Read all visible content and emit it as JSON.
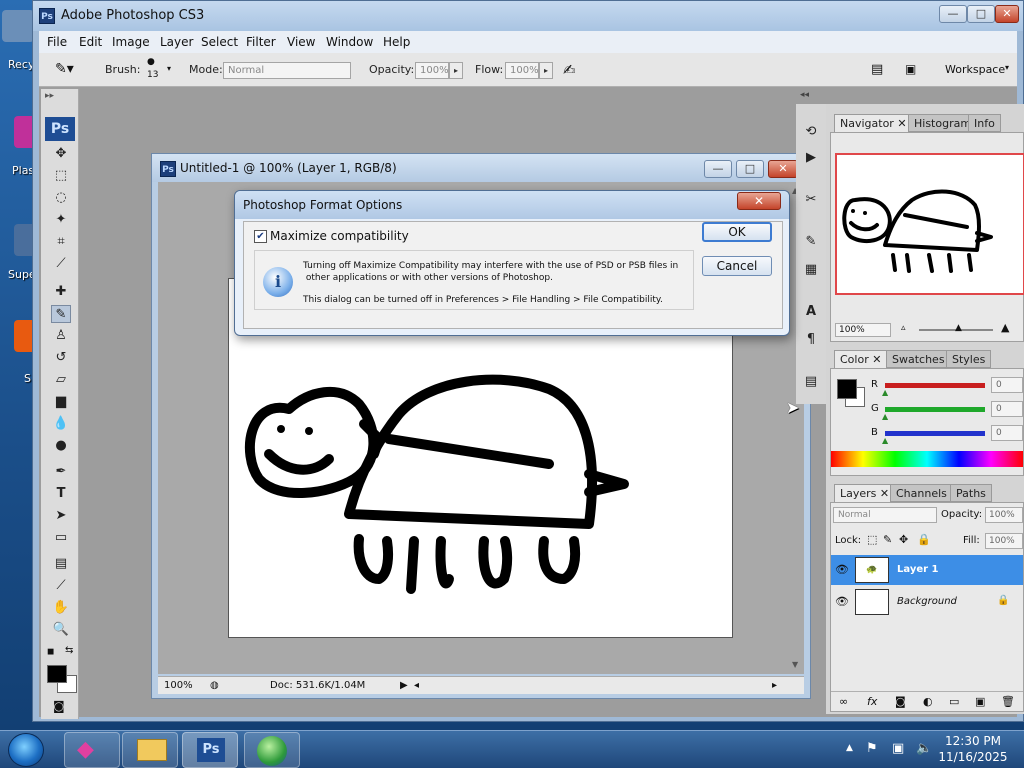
{
  "desktop": {
    "icons": [
      {
        "label": "Recy",
        "color": "#6b8fb8"
      },
      {
        "label": "Plas",
        "color": "#c0309a"
      },
      {
        "label": "Supe",
        "color": "#4a6e9c"
      },
      {
        "label": "S",
        "color": "#e85a10"
      }
    ]
  },
  "window": {
    "app_icon": "Ps",
    "title": "Adobe Photoshop CS3",
    "controls": {
      "minimize": "—",
      "maximize": "□",
      "close": "✕"
    }
  },
  "menubar": [
    "File",
    "Edit",
    "Image",
    "Layer",
    "Select",
    "Filter",
    "View",
    "Window",
    "Help"
  ],
  "options_bar": {
    "brush_label": "Brush:",
    "brush_size": "13",
    "mode_label": "Mode:",
    "mode_value": "Normal",
    "opacity_label": "Opacity:",
    "opacity_value": "100%",
    "flow_label": "Flow:",
    "flow_value": "100%",
    "workspace_label": "Workspace"
  },
  "toolbox": {
    "logo": "Ps",
    "tools": [
      "move-tool",
      "marquee-tool",
      "lasso-tool",
      "magic-wand-tool",
      "crop-tool",
      "slice-tool",
      "healing-brush-tool",
      "brush-tool",
      "clone-stamp-tool",
      "history-brush-tool",
      "eraser-tool",
      "gradient-tool",
      "blur-tool",
      "dodge-tool",
      "pen-tool",
      "type-tool",
      "path-selection-tool",
      "shape-tool",
      "notes-tool",
      "eyedropper-tool",
      "hand-tool",
      "zoom-tool"
    ],
    "foreground_color": "#000000",
    "background_color": "#ffffff"
  },
  "document": {
    "title": "Untitled-1 @ 100% (Layer 1, RGB/8)",
    "zoom": "100%",
    "doc_info": "Doc: 531.6K/1.04M"
  },
  "dialog": {
    "title": "Photoshop Format Options",
    "close": "✕",
    "checkbox_label": "Maximize compatibility",
    "checkbox_checked": true,
    "message_line1": "Turning off Maximize Compatibility may interfere with the use of PSD or PSB files in",
    "message_line2": " other applications or with other versions of Photoshop.",
    "message_line3": "This dialog can be turned off in Preferences > File Handling > File Compatibility.",
    "ok": "OK",
    "cancel": "Cancel"
  },
  "navigator_panel": {
    "tabs": [
      "Navigator",
      "Histogram",
      "Info"
    ],
    "zoom": "100%"
  },
  "color_panel": {
    "tabs": [
      "Color",
      "Swatches",
      "Styles"
    ],
    "channels": [
      {
        "label": "R",
        "value": "0",
        "color": "#c81e1e"
      },
      {
        "label": "G",
        "value": "0",
        "color": "#1fa82b"
      },
      {
        "label": "B",
        "value": "0",
        "color": "#2233cc"
      }
    ]
  },
  "layers_panel": {
    "tabs": [
      "Layers",
      "Channels",
      "Paths"
    ],
    "blend_mode": "Normal",
    "opacity_label": "Opacity:",
    "opacity_value": "100%",
    "lock_label": "Lock:",
    "fill_label": "Fill:",
    "fill_value": "100%",
    "layers": [
      {
        "name": "Layer 1",
        "selected": true
      },
      {
        "name": "Background",
        "selected": false
      }
    ]
  },
  "taskbar": {
    "time": "12:30 PM",
    "date": "11/16/2025"
  },
  "colors": {
    "accent_blue": "#3c8ee8",
    "selected_layer": "#3d8ee6"
  }
}
